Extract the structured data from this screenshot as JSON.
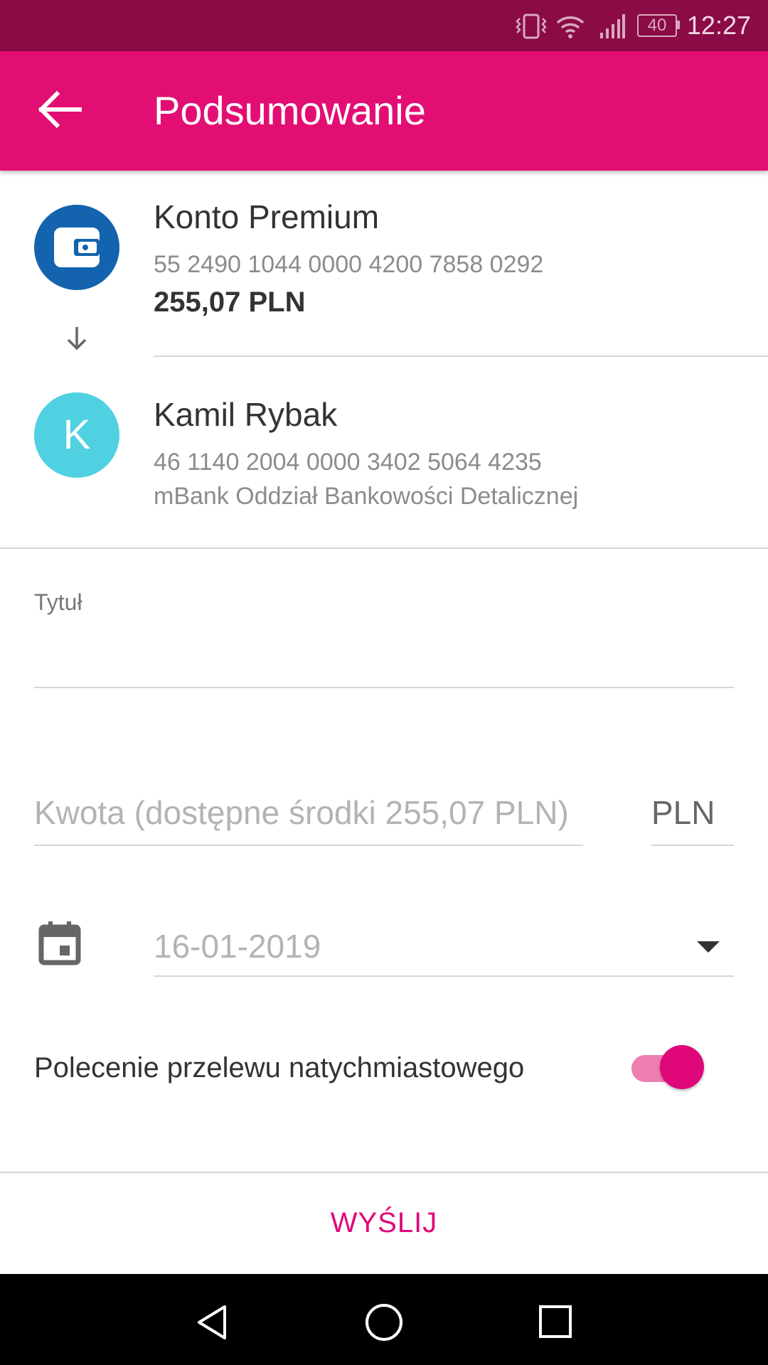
{
  "status_bar": {
    "time": "12:27",
    "battery": "40"
  },
  "app_bar": {
    "title": "Podsumowanie"
  },
  "source_account": {
    "name": "Konto Premium",
    "number": "55 2490 1044 0000 4200 7858 0292",
    "balance": "255,07 PLN"
  },
  "recipient": {
    "initial": "K",
    "name": "Kamil Rybak",
    "number": "46 1140 2004 0000 3402 5064 4235",
    "bank": "mBank Oddział Bankowości Detalicznej"
  },
  "form": {
    "title_label": "Tytuł",
    "title_value": "",
    "amount_placeholder": "Kwota (dostępne środki 255,07 PLN)",
    "currency": "PLN",
    "date": "16-01-2019",
    "instant_label": "Polecenie przelewu natychmiastowego",
    "instant_enabled": true
  },
  "action": {
    "send_label": "WYŚLIJ"
  },
  "colors": {
    "status_bar": "#8a0b45",
    "app_bar": "#e20e73",
    "accent": "#e0077a",
    "wallet_avatar": "#1463ae",
    "recipient_avatar": "#4fd1e2"
  },
  "icons": [
    "vibrate-icon",
    "wifi-icon",
    "signal-icon",
    "battery-icon",
    "back-arrow-icon",
    "wallet-icon",
    "down-arrow-icon",
    "calendar-icon",
    "dropdown-arrow-icon",
    "nav-back-icon",
    "nav-home-icon",
    "nav-recents-icon"
  ]
}
